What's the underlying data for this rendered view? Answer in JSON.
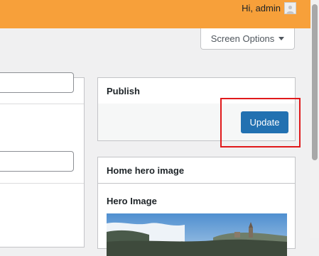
{
  "admin_bar": {
    "greeting": "Hi, admin",
    "color": "#f7a03a"
  },
  "screen_options": {
    "label": "Screen Options"
  },
  "publish": {
    "title": "Publish",
    "update_label": "Update",
    "button_color": "#2271b1"
  },
  "hero_box": {
    "title": "Home hero image",
    "field_label": "Hero Image"
  },
  "highlight": {
    "color": "#e0191b"
  }
}
